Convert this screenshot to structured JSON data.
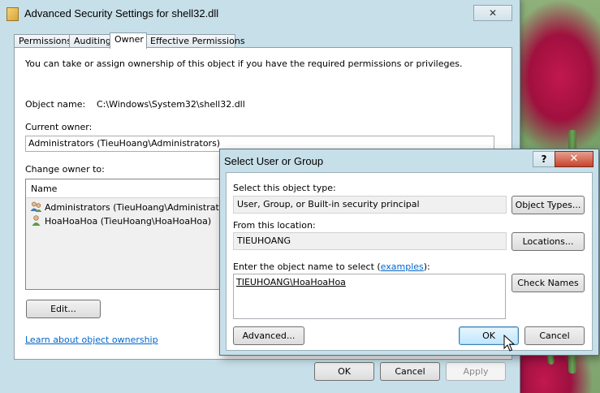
{
  "window": {
    "title": "Advanced Security Settings for shell32.dll",
    "close_glyph": "✕"
  },
  "tabs": [
    {
      "label": "Permissions"
    },
    {
      "label": "Auditing"
    },
    {
      "label": "Owner"
    },
    {
      "label": "Effective Permissions"
    }
  ],
  "owner_tab": {
    "intro": "You can take or assign ownership of this object if you have the required permissions or privileges.",
    "object_name_label": "Object name:",
    "object_name_value": "C:\\Windows\\System32\\shell32.dll",
    "current_owner_label": "Current owner:",
    "current_owner_value": "Administrators (TieuHoang\\Administrators)",
    "change_owner_label": "Change owner to:",
    "list_header_name": "Name",
    "owners": [
      {
        "name": "Administrators (TieuHoang\\Administrators)",
        "icon": "group-icon"
      },
      {
        "name": "HoaHoaHoa (TieuHoang\\HoaHoaHoa)",
        "icon": "user-icon"
      }
    ],
    "edit_button": "Edit...",
    "learn_link": "Learn about object ownership"
  },
  "main_buttons": {
    "ok": "OK",
    "cancel": "Cancel",
    "apply": "Apply"
  },
  "dialog": {
    "title": "Select User or Group",
    "help_glyph": "?",
    "close_glyph": "✕",
    "object_type_label": "Select this object type:",
    "object_type_value": "User, Group, or Built-in security principal",
    "object_types_button": "Object Types...",
    "location_label": "From this location:",
    "location_value": "TIEUHOANG",
    "locations_button": "Locations...",
    "enter_label": "Enter the object name to select (",
    "enter_link": "examples",
    "enter_label_end": "):",
    "object_name_input": "TIEUHOANG\\HoaHoaHoa",
    "check_names_button": "Check Names",
    "advanced_button": "Advanced...",
    "ok_button": "OK",
    "cancel_button": "Cancel"
  },
  "colors": {
    "window_frame": "#c7dfe9",
    "link": "#0066cc",
    "close_red": "#c8432b"
  }
}
